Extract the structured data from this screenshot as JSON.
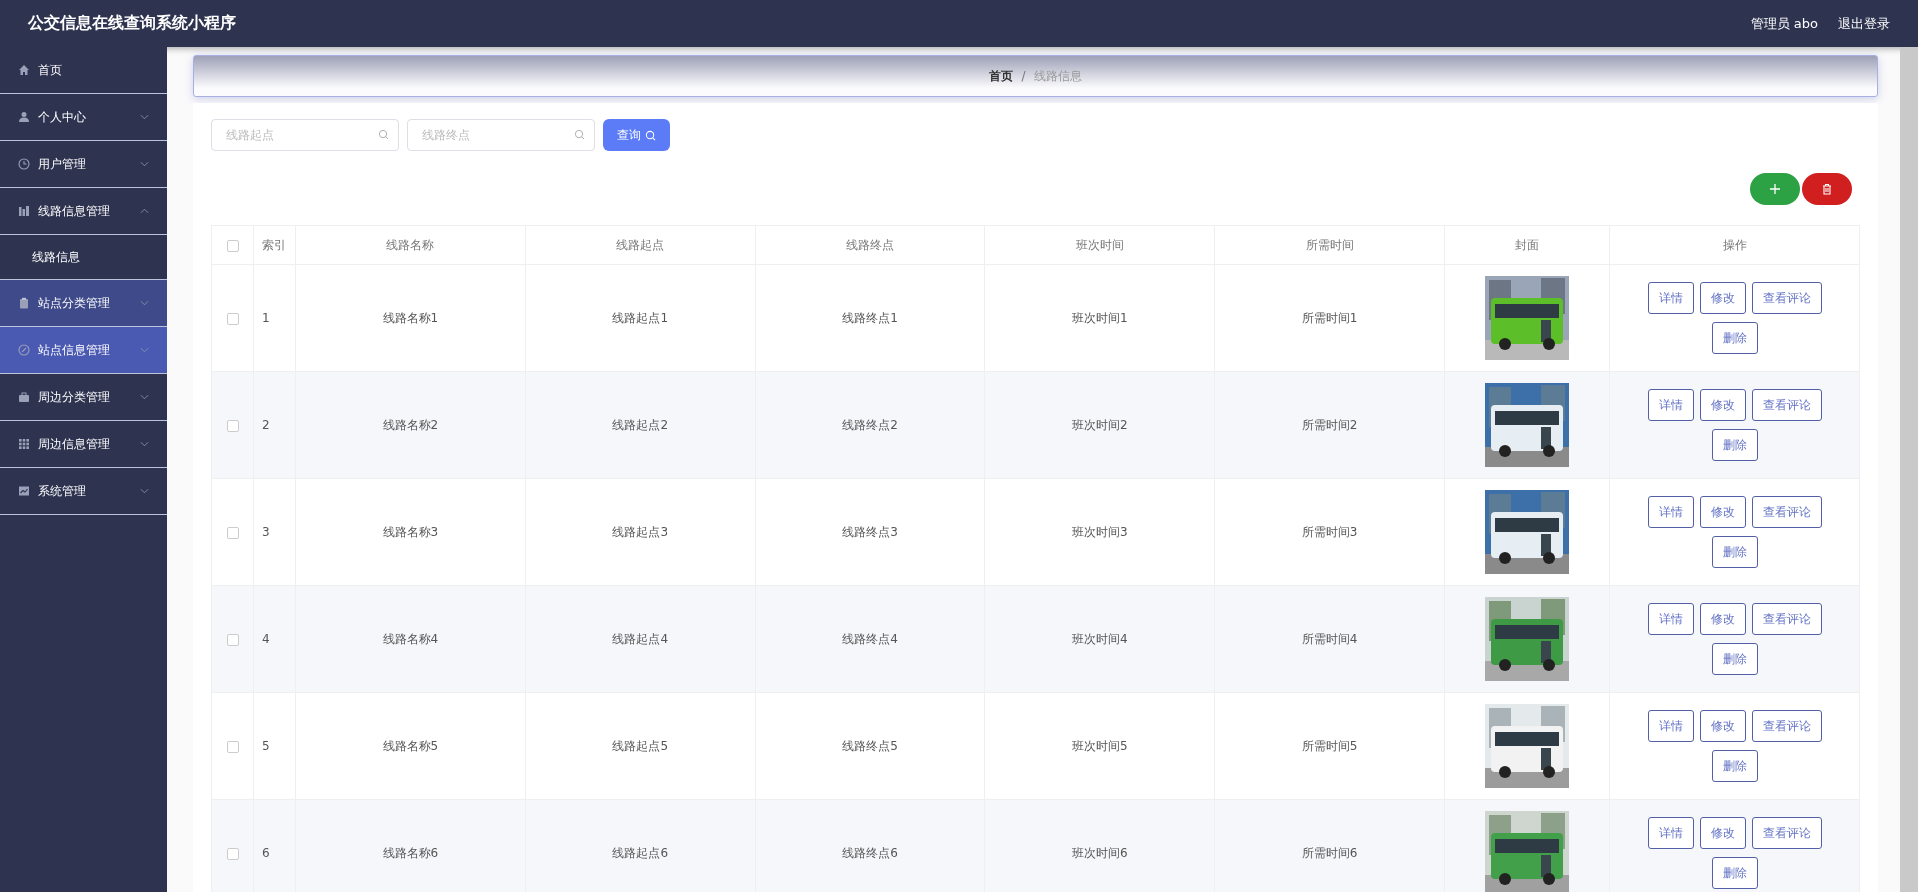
{
  "header": {
    "title": "公交信息在线查询系统小程序",
    "user": "管理员 abo",
    "logout": "退出登录"
  },
  "sidebar": {
    "items": [
      {
        "label": "首页",
        "selected": false,
        "hovered": false
      },
      {
        "label": "个人中心",
        "expanded": false,
        "selected": false,
        "hovered": false
      },
      {
        "label": "用户管理",
        "expanded": false,
        "selected": false,
        "hovered": false
      },
      {
        "label": "线路信息管理",
        "expanded": true,
        "selected": false,
        "hovered": false,
        "children": [
          {
            "label": "线路信息"
          }
        ]
      },
      {
        "label": "站点分类管理",
        "expanded": false,
        "selected": true,
        "hovered": false
      },
      {
        "label": "站点信息管理",
        "expanded": false,
        "selected": false,
        "hovered": true
      },
      {
        "label": "周边分类管理",
        "expanded": false,
        "selected": false,
        "hovered": false
      },
      {
        "label": "周边信息管理",
        "expanded": false,
        "selected": false,
        "hovered": false
      },
      {
        "label": "系统管理",
        "expanded": false,
        "selected": false,
        "hovered": false
      }
    ]
  },
  "breadcrumb_separator": "/",
  "breadcrumb": [
    {
      "label": "首页",
      "current": false
    },
    {
      "label": "线路信息",
      "current": true
    }
  ],
  "search": {
    "fields": [
      {
        "placeholder": "线路起点"
      },
      {
        "placeholder": "线路终点"
      }
    ],
    "button": "查询"
  },
  "table": {
    "header_checked": false,
    "columns": [
      "索引",
      "线路名称",
      "线路起点",
      "线路终点",
      "班次时间",
      "所需时间",
      "封面",
      "操作"
    ],
    "rows": [
      {
        "checked": false,
        "index": "1",
        "name": "线路名称1",
        "start": "线路起点1",
        "end": "线路终点1",
        "schedule": "班次时间1",
        "duration": "所需时间1",
        "actions": [
          "详情",
          "修改",
          "查看评论",
          "删除"
        ]
      },
      {
        "checked": false,
        "index": "2",
        "name": "线路名称2",
        "start": "线路起点2",
        "end": "线路终点2",
        "schedule": "班次时间2",
        "duration": "所需时间2",
        "actions": [
          "详情",
          "修改",
          "查看评论",
          "删除"
        ]
      },
      {
        "checked": false,
        "index": "3",
        "name": "线路名称3",
        "start": "线路起点3",
        "end": "线路终点3",
        "schedule": "班次时间3",
        "duration": "所需时间3",
        "actions": [
          "详情",
          "修改",
          "查看评论",
          "删除"
        ]
      },
      {
        "checked": false,
        "index": "4",
        "name": "线路名称4",
        "start": "线路起点4",
        "end": "线路终点4",
        "schedule": "班次时间4",
        "duration": "所需时间4",
        "actions": [
          "详情",
          "修改",
          "查看评论",
          "删除"
        ]
      },
      {
        "checked": false,
        "index": "5",
        "name": "线路名称5",
        "start": "线路起点5",
        "end": "线路终点5",
        "schedule": "班次时间5",
        "duration": "所需时间5",
        "actions": [
          "详情",
          "修改",
          "查看评论",
          "删除"
        ]
      },
      {
        "checked": false,
        "index": "6",
        "name": "线路名称6",
        "start": "线路起点6",
        "end": "线路终点6",
        "schedule": "班次时间6",
        "duration": "所需时间6",
        "actions": [
          "详情",
          "修改",
          "查看评论",
          "删除"
        ]
      }
    ]
  }
}
